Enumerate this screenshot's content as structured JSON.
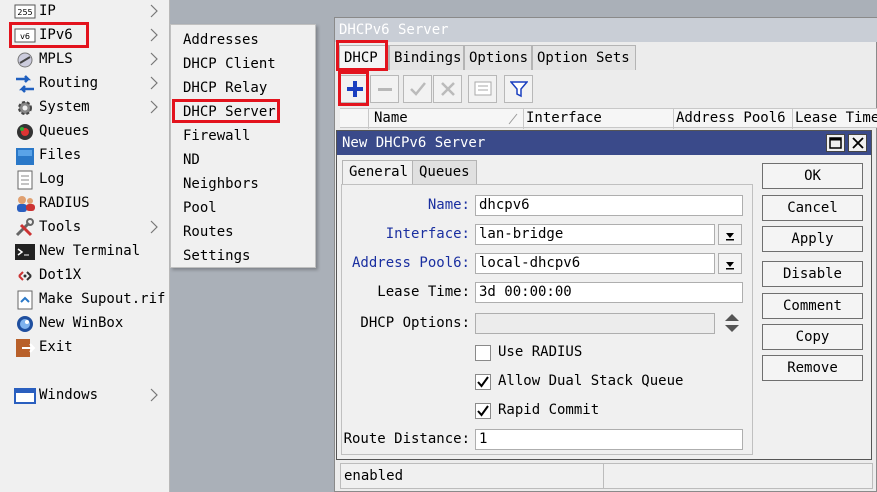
{
  "sidebar": {
    "items": [
      {
        "label": "IP",
        "icon": "ip-icon"
      },
      {
        "label": "IPv6",
        "icon": "ipv6-icon"
      },
      {
        "label": "MPLS",
        "icon": "mpls-icon"
      },
      {
        "label": "Routing",
        "icon": "routing-icon"
      },
      {
        "label": "System",
        "icon": "system-gear-icon"
      },
      {
        "label": "Queues",
        "icon": "queues-icon"
      },
      {
        "label": "Files",
        "icon": "folder-icon"
      },
      {
        "label": "Log",
        "icon": "log-icon"
      },
      {
        "label": "RADIUS",
        "icon": "radius-users-icon"
      },
      {
        "label": "Tools",
        "icon": "tools-icon"
      },
      {
        "label": "New Terminal",
        "icon": "terminal-icon"
      },
      {
        "label": "Dot1X",
        "icon": "dot1x-icon"
      },
      {
        "label": "Make Supout.rif",
        "icon": "supout-icon"
      },
      {
        "label": "New WinBox",
        "icon": "winbox-icon"
      },
      {
        "label": "Exit",
        "icon": "exit-icon"
      },
      {
        "label": "Windows",
        "icon": "windows-icon"
      }
    ],
    "ip_badge": "255",
    "ipv6_badge": "v6"
  },
  "ipv6_submenu": {
    "items": [
      "Addresses",
      "DHCP Client",
      "DHCP Relay",
      "DHCP Server",
      "Firewall",
      "ND",
      "Neighbors",
      "Pool",
      "Routes",
      "Settings"
    ]
  },
  "server_window": {
    "title": "DHCPv6 Server",
    "tabs": [
      "DHCP",
      "Bindings",
      "Options",
      "Option Sets"
    ],
    "columns": [
      "Name",
      "Interface",
      "Address Pool6",
      "Lease Time"
    ],
    "status": "enabled"
  },
  "dialog": {
    "title": "New DHCPv6 Server",
    "tabs": [
      "General",
      "Queues"
    ],
    "fields": {
      "name_label": "Name:",
      "name_value": "dhcpv6",
      "interface_label": "Interface:",
      "interface_value": "lan-bridge",
      "pool_label": "Address Pool6:",
      "pool_value": "local-dhcpv6",
      "lease_label": "Lease Time:",
      "lease_value": "3d 00:00:00",
      "options_label": "DHCP Options:",
      "options_value": "",
      "use_radius_label": "Use RADIUS",
      "use_radius_checked": false,
      "dual_stack_label": "Allow Dual Stack Queue",
      "dual_stack_checked": true,
      "rapid_commit_label": "Rapid Commit",
      "rapid_commit_checked": true,
      "route_distance_label": "Route Distance:",
      "route_distance_value": "1"
    },
    "buttons": [
      "OK",
      "Cancel",
      "Apply",
      "Disable",
      "Comment",
      "Copy",
      "Remove"
    ]
  },
  "colors": {
    "highlight": "#e3131d",
    "dialog_title_bg": "#3a4a8a",
    "add_button_blue": "#1a3fbf",
    "label_blue": "#1a2fa0"
  }
}
